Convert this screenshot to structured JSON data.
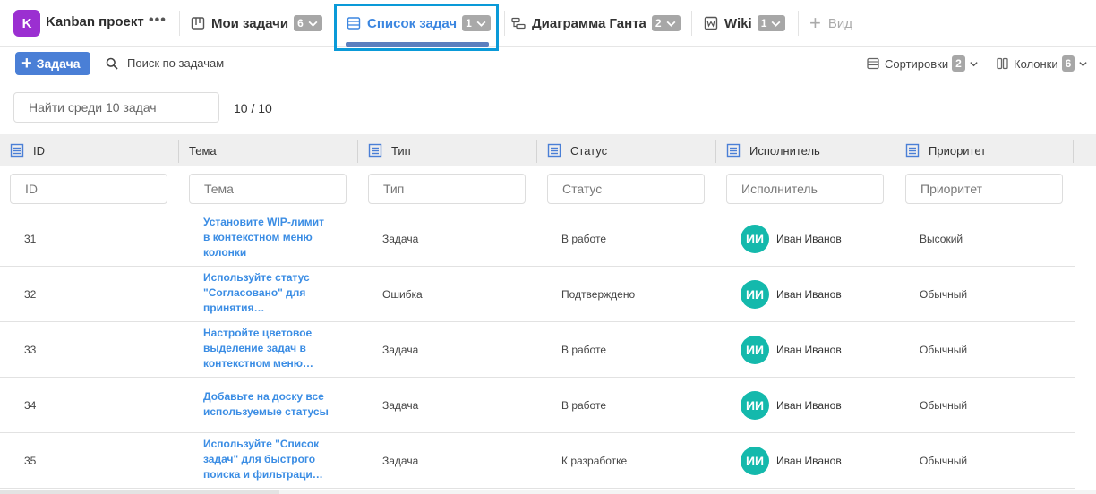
{
  "project": {
    "avatar_letter": "K",
    "name": "Kanban проект",
    "more": "•••",
    "avatar_color": "#9b2fd1"
  },
  "tabs": [
    {
      "label": "Мои задачи",
      "count": "6",
      "icon": "board-icon"
    },
    {
      "label": "Список задач",
      "count": "1",
      "icon": "list-icon",
      "active": true
    },
    {
      "label": "Диаграмма Ганта",
      "count": "2",
      "icon": "gantt-icon"
    },
    {
      "label": "Wiki",
      "count": "1",
      "icon": "wiki-icon"
    },
    {
      "label": "Вид",
      "icon": "plus-icon"
    }
  ],
  "toolbar": {
    "add_task_label": "Задача",
    "search_label": "Поиск по задачам",
    "sort_label": "Сортировки",
    "sort_count": "2",
    "columns_label": "Колонки",
    "columns_count": "6"
  },
  "filter": {
    "placeholder": "Найти среди 10 задач",
    "result_count": "10 / 10"
  },
  "columns": [
    {
      "label": "ID",
      "filter_placeholder": "ID"
    },
    {
      "label": "Тема",
      "filter_placeholder": "Тема"
    },
    {
      "label": "Тип",
      "filter_placeholder": "Тип"
    },
    {
      "label": "Статус",
      "filter_placeholder": "Статус"
    },
    {
      "label": "Исполнитель",
      "filter_placeholder": "Исполнитель"
    },
    {
      "label": "Приоритет",
      "filter_placeholder": "Приоритет"
    }
  ],
  "rows": [
    {
      "id": "31",
      "title_lines": [
        "Установите WIP-лимит",
        "в контекстном меню",
        "колонки"
      ],
      "type": "Задача",
      "status": "В работе",
      "assignee_initials": "ИИ",
      "assignee": "Иван Иванов",
      "priority": "Высокий"
    },
    {
      "id": "32",
      "title_lines": [
        "Используйте статус",
        "\"Согласовано\" для",
        "принятия…"
      ],
      "type": "Ошибка",
      "status": "Подтверждено",
      "assignee_initials": "ИИ",
      "assignee": "Иван Иванов",
      "priority": "Обычный"
    },
    {
      "id": "33",
      "title_lines": [
        "Настройте цветовое",
        "выделение задач в",
        "контекстном меню…"
      ],
      "type": "Задача",
      "status": "В работе",
      "assignee_initials": "ИИ",
      "assignee": "Иван Иванов",
      "priority": "Обычный"
    },
    {
      "id": "34",
      "title_lines": [
        "Добавьте на доску все",
        "используемые статусы"
      ],
      "type": "Задача",
      "status": "В работе",
      "assignee_initials": "ИИ",
      "assignee": "Иван Иванов",
      "priority": "Обычный"
    },
    {
      "id": "35",
      "title_lines": [
        "Используйте \"Список",
        "задач\" для быстрого",
        "поиска и фильтраци…"
      ],
      "type": "Задача",
      "status": "К разработке",
      "assignee_initials": "ИИ",
      "assignee": "Иван Иванов",
      "priority": "Обычный"
    }
  ],
  "colors": {
    "accent": "#3b86e0",
    "primary_button": "#4a7fd6",
    "avatar": "#14b9ac",
    "highlight_frame": "#0a9ad8"
  }
}
